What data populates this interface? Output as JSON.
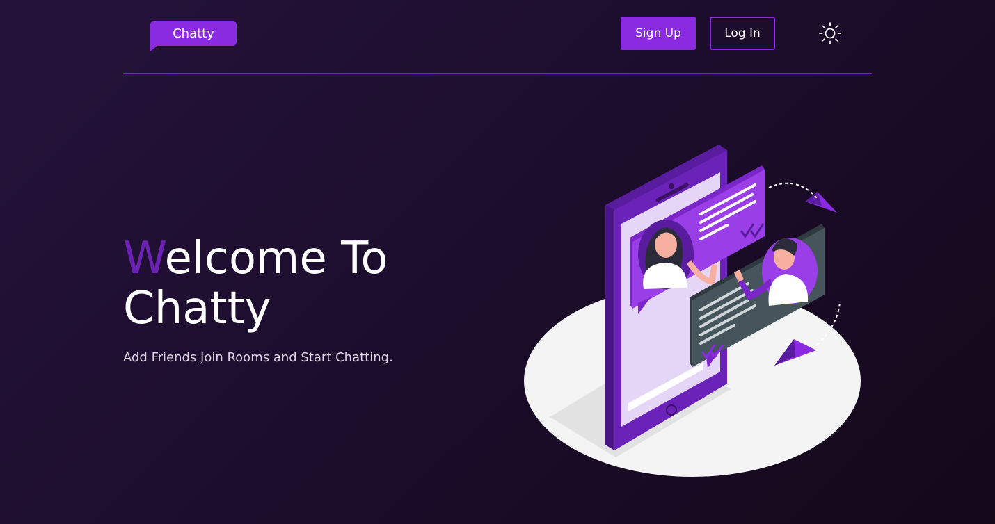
{
  "header": {
    "logo_text": "Chatty",
    "signup_label": "Sign Up",
    "login_label": "Log In",
    "theme_icon": "sun-icon"
  },
  "hero": {
    "title_first_letter": "W",
    "title_rest_line1": "elcome To",
    "title_line2": "Chatty",
    "subtitle": "Add Friends Join Rooms and Start Chatting."
  },
  "colors": {
    "accent": "#8a2be2",
    "title_accent": "#6c21b5",
    "background": "#1e0f2d"
  },
  "illustration": {
    "name": "people-chatting-on-phone-illustration"
  }
}
